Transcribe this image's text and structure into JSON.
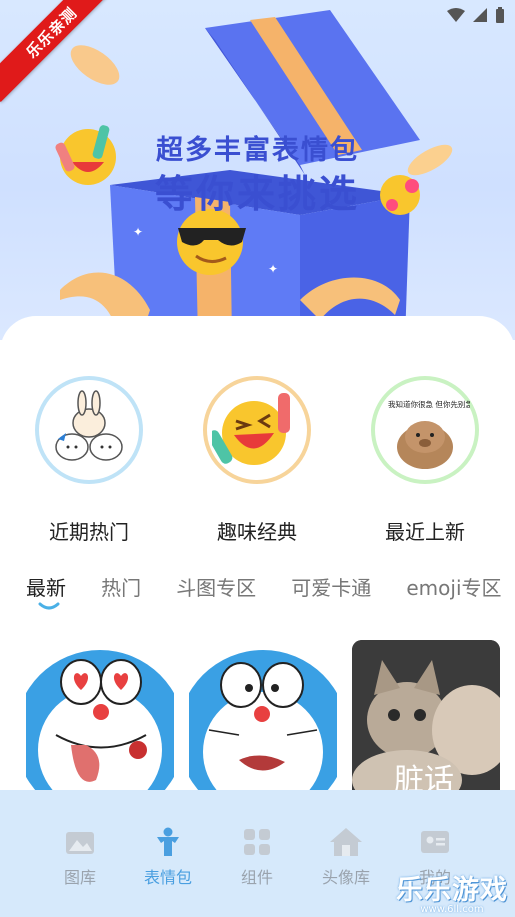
{
  "ribbon": "乐乐亲测",
  "hero": {
    "title_line1": "超多丰富表情包",
    "title_line2": "等你来挑选"
  },
  "categories": [
    {
      "label": "近期热门",
      "icon": "bunny-bear-sticker-icon"
    },
    {
      "label": "趣味经典",
      "icon": "laughing-emoji-icon"
    },
    {
      "label": "最近上新",
      "icon": "capybara-sticker-icon",
      "caption": "我知道你很急 但你先别急"
    }
  ],
  "tabs": [
    "最新",
    "热门",
    "斗图专区",
    "可爱卡通",
    "emoji专区"
  ],
  "active_tab": 0,
  "cards": [
    {
      "icon": "doraemon-heart-eyes-icon"
    },
    {
      "icon": "doraemon-worried-icon"
    },
    {
      "icon": "cat-meme-icon",
      "caption": "脏话"
    }
  ],
  "bottom_nav": [
    {
      "label": "图库",
      "icon": "gallery-icon"
    },
    {
      "label": "表情包",
      "icon": "emoji-person-icon",
      "active": true
    },
    {
      "label": "组件",
      "icon": "grid-icon"
    },
    {
      "label": "头像库",
      "icon": "home-icon"
    },
    {
      "label": "我的",
      "icon": "profile-card-icon"
    }
  ],
  "watermark": {
    "brand": "乐乐游戏",
    "url": "www.6ll.com"
  },
  "colors": {
    "accent": "#4a9fe0",
    "title": "#3a4fd1",
    "ribbon": "#e01a1a",
    "nav_bg": "#d6e9fb"
  }
}
